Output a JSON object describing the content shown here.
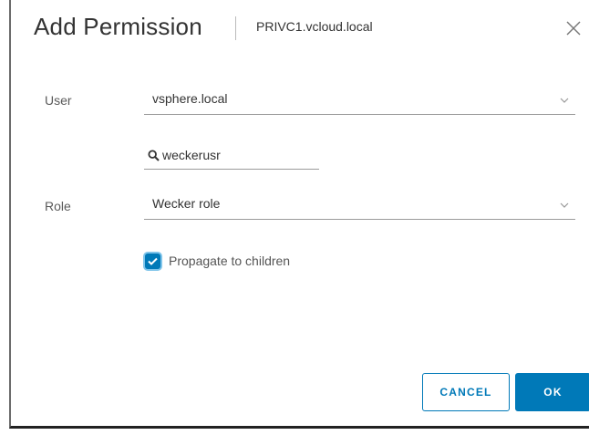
{
  "dialog": {
    "title": "Add Permission",
    "subtitle": "PRIVC1.vcloud.local"
  },
  "form": {
    "user_label": "User",
    "user_domain": "vsphere.local",
    "search_value": "weckerusr",
    "role_label": "Role",
    "role_value": "Wecker role",
    "propagate_label": "Propagate to children",
    "propagate_checked": true
  },
  "footer": {
    "cancel_label": "CANCEL",
    "ok_label": "OK"
  },
  "icons": {
    "close": "close-icon",
    "search": "search-icon",
    "chevron": "chevron-down-icon",
    "check": "checkmark-icon"
  },
  "colors": {
    "accent": "#0079b8",
    "accent_focus": "#7fc4ea",
    "text": "#333333",
    "label": "#5a5a5a"
  }
}
